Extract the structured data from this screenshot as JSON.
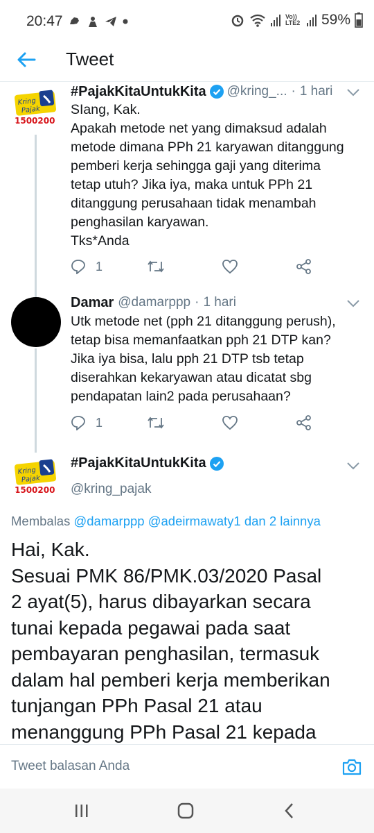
{
  "status_bar": {
    "time": "20:47",
    "battery": "59%",
    "icons": [
      "whatsapp-icon",
      "avast-icon",
      "telegram-icon",
      "dot-icon",
      "alarm-icon",
      "wifi-icon",
      "signal-icon",
      "volte-icon",
      "signal-icon",
      "battery-icon"
    ],
    "volte_label": "Vo)) LTE2"
  },
  "header": {
    "title": "Tweet",
    "back_icon": "arrow-left-icon"
  },
  "avatar_logo": {
    "line1": "Kring",
    "line2": "Pajak",
    "number": "1500200"
  },
  "tweets": [
    {
      "name": "#PajakKitaUntukKita",
      "verified": true,
      "handle": "@kring_...",
      "separator": "·",
      "time": "1 hari",
      "lines": [
        "SIang, Kak.",
        "Apakah metode net yang dimaksud adalah",
        "metode dimana PPh 21 karyawan ditanggung",
        "pemberi kerja sehingga gaji yang diterima",
        "tetap utuh? Jika iya, maka untuk PPh 21",
        "ditanggung perusahaan tidak menambah",
        "penghasilan karyawan.",
        "Tks*Anda"
      ],
      "reply_count": "1"
    },
    {
      "name": "Damar",
      "verified": false,
      "handle": "@damarppp",
      "separator": "·",
      "time": "1 hari",
      "lines": [
        "Utk metode net (pph 21 ditanggung perush),",
        "tetap bisa memanfaatkan pph 21 DTP kan?",
        "Jika iya bisa, lalu pph 21 DTP tsb tetap",
        "diserahkan kekaryawan atau dicatat sbg",
        "pendapatan lain2 pada perusahaan?"
      ],
      "reply_count": "1"
    }
  ],
  "main_tweet": {
    "name": "#PajakKitaUntukKita",
    "verified": true,
    "handle": "@kring_pajak",
    "reply_prefix": "Membalas",
    "mentions": [
      "@damarppp",
      "@adeirmawaty1"
    ],
    "reply_suffix": "dan 2 lainnya",
    "lines": [
      "Hai, Kak.",
      "Sesuai PMK 86/PMK.03/2020 Pasal",
      "2 ayat(5), harus dibayarkan secara",
      "tunai kepada pegawai pada saat",
      "pembayaran penghasilan, termasuk",
      "dalam hal pemberi kerja memberikan",
      "tunjangan PPh Pasal 21 atau",
      "menanggung PPh Pasal 21 kepada"
    ]
  },
  "reply_bar": {
    "placeholder": "Tweet balasan Anda"
  },
  "colors": {
    "accent": "#1da1f2",
    "muted": "#657786",
    "text": "#14171a",
    "logo_yellow": "#f5d400",
    "logo_red": "#d7141a",
    "logo_blue": "#1a3f8f"
  }
}
